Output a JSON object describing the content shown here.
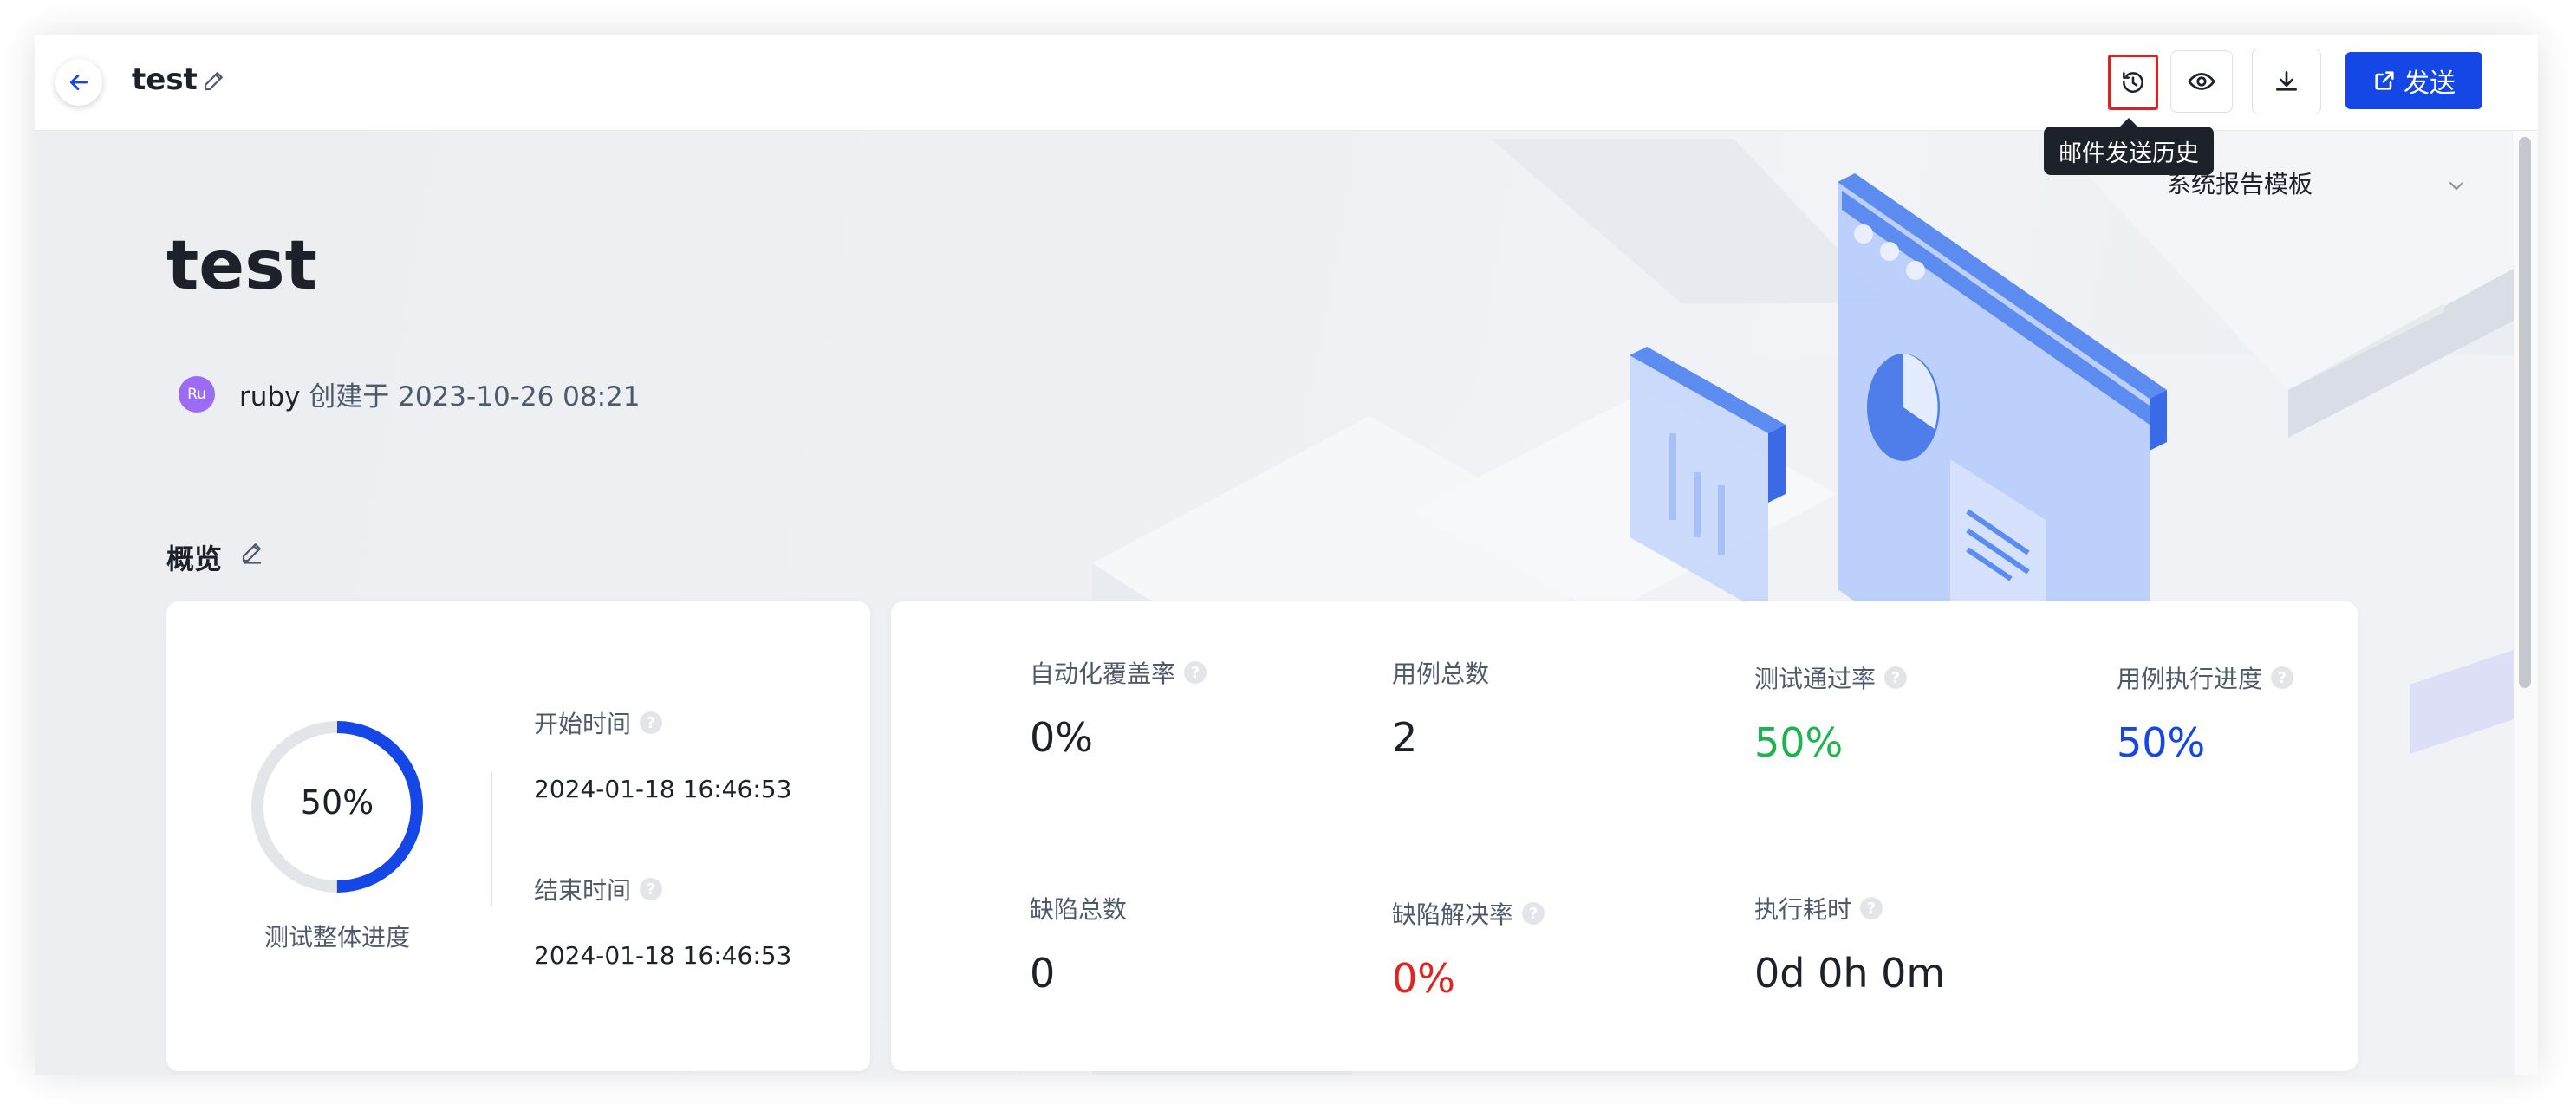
{
  "header": {
    "title": "test",
    "send_label": "发送",
    "tooltip": "邮件发送历史"
  },
  "template_select": {
    "value": "系统报告模板"
  },
  "report": {
    "title": "test",
    "avatar_initials": "Ru",
    "creator": "ruby",
    "created_prefix": "创建于",
    "created_at": "2023-10-26 08:21"
  },
  "overview": {
    "title": "概览",
    "progress": {
      "value_text": "50%",
      "fraction": 0.5,
      "label": "测试整体进度"
    },
    "start_label": "开始时间",
    "start_value": "2024-01-18 16:46:53",
    "end_label": "结束时间",
    "end_value": "2024-01-18 16:46:53",
    "metrics": [
      {
        "label": "自动化覆盖率",
        "value": "0%",
        "has_help": true
      },
      {
        "label": "用例总数",
        "value": "2",
        "has_help": false
      },
      {
        "label": "测试通过率",
        "value": "50%",
        "has_help": true,
        "color": "#1fb34f"
      },
      {
        "label": "用例执行进度",
        "value": "50%",
        "has_help": true,
        "color": "#1447e6"
      },
      {
        "label": "缺陷总数",
        "value": "0",
        "has_help": false
      },
      {
        "label": "缺陷解决率",
        "value": "0%",
        "has_help": true,
        "color": "#e0241f"
      },
      {
        "label": "执行耗时",
        "value": "0d 0h 0m",
        "has_help": true
      }
    ]
  },
  "colors": {
    "primary": "#1447e6",
    "success": "#1fb34f",
    "danger": "#e0241f",
    "avatar": "#9b6cf3"
  },
  "icons": [
    "arrow-left-icon",
    "pencil-icon",
    "history-icon",
    "eye-icon",
    "download-icon",
    "share-icon",
    "chevron-down-icon",
    "help-icon"
  ]
}
